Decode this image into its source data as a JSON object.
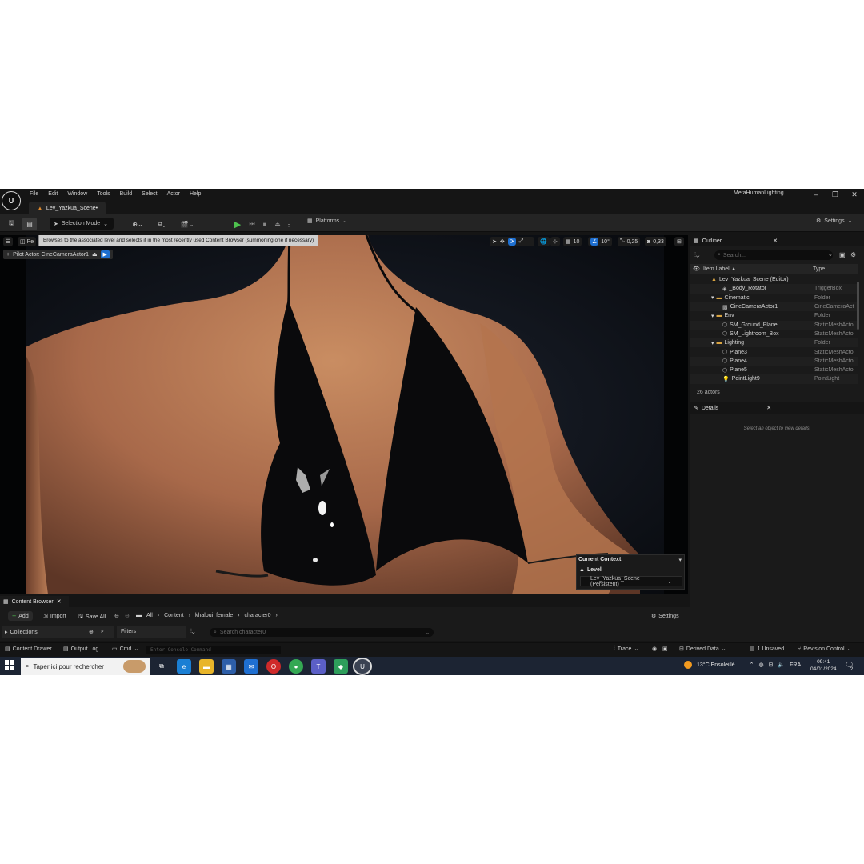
{
  "menubar": {
    "items": [
      "File",
      "Edit",
      "Window",
      "Tools",
      "Build",
      "Select",
      "Actor",
      "Help"
    ],
    "project_name": "MetaHumanLighting",
    "level_tab": "Lev_Yazkua_Scene•"
  },
  "toolbar": {
    "selection_mode": "Selection Mode",
    "platforms": "Platforms",
    "settings": "Settings"
  },
  "viewport": {
    "perspective_label": "Pe",
    "tooltip": "Browses to the associated level and selects it in the most recently used Content Browser (summoning one if necessary)",
    "pilot_actor": "Pilot Actor: CineCameraActor1",
    "grid_snap": "10",
    "rotation_snap": "10°",
    "scale_snap": "0,25",
    "camera_speed": "0,33",
    "current_context": {
      "title": "Current Context",
      "level_label": "Level",
      "level_value": "Lev_Yazkua_Scene (Persistent)"
    }
  },
  "outliner": {
    "tab": "Outliner",
    "search_placeholder": "Search...",
    "col_label": "Item Label ▲",
    "col_type": "Type",
    "rows": [
      {
        "label": "Lev_Yazkua_Scene (Editor)",
        "type": ""
      },
      {
        "label": "_Body_Rotator",
        "type": "TriggerBox"
      },
      {
        "label": "Cinematic",
        "type": "Folder"
      },
      {
        "label": "CineCameraActor1",
        "type": "CineCameraAct"
      },
      {
        "label": "Env",
        "type": "Folder"
      },
      {
        "label": "SM_Ground_Plane",
        "type": "StaticMeshActo"
      },
      {
        "label": "SM_Lightroom_Box",
        "type": "StaticMeshActo"
      },
      {
        "label": "Lighting",
        "type": "Folder"
      },
      {
        "label": "Plane3",
        "type": "StaticMeshActo"
      },
      {
        "label": "Plane4",
        "type": "StaticMeshActo"
      },
      {
        "label": "Plane5",
        "type": "StaticMeshActo"
      },
      {
        "label": "PointLight9",
        "type": "PointLight"
      }
    ],
    "actor_count": "26 actors"
  },
  "details": {
    "tab": "Details",
    "hint": "Select an object to view details."
  },
  "content_browser": {
    "tab": "Content Browser",
    "add": "Add",
    "import": "Import",
    "save_all": "Save All",
    "path": [
      "All",
      "Content",
      "khaloui_female",
      "character0"
    ],
    "settings": "Settings",
    "collections": "Collections",
    "filters": "Filters",
    "search_placeholder": "Search character0"
  },
  "statusbar": {
    "content_drawer": "Content Drawer",
    "output_log": "Output Log",
    "cmd": "Cmd",
    "console_placeholder": "Enter Console Command",
    "trace": "Trace",
    "derived_data": "Derived Data",
    "unsaved": "1 Unsaved",
    "revision_control": "Revision Control"
  },
  "taskbar": {
    "search_placeholder": "Taper ici pour rechercher",
    "weather": "13°C  Ensoleillé",
    "language": "FRA",
    "time": "09:41",
    "date": "04/01/2024",
    "notification_count": "2"
  }
}
